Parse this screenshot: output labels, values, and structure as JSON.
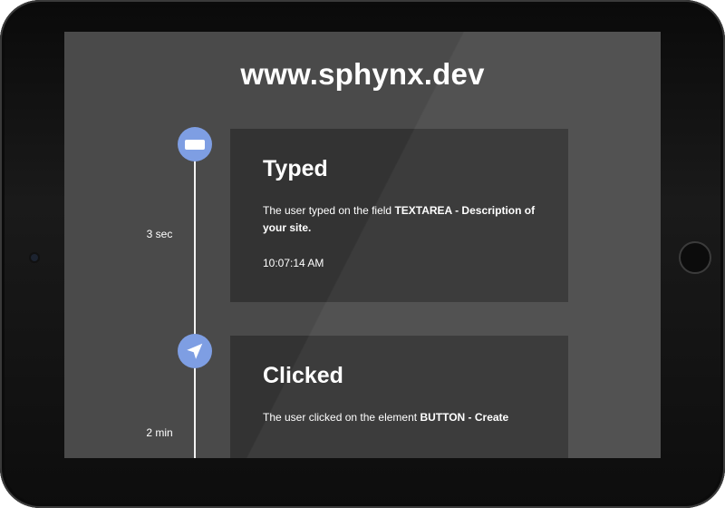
{
  "site": {
    "title": "www.sphynx.dev"
  },
  "events": [
    {
      "title": "Typed",
      "desc_prefix": "The user typed on the field ",
      "desc_strong": "TEXTAREA - Description of your site.",
      "time": "10:07:14 AM",
      "elapsed": "3 sec",
      "icon": "keyboard-icon"
    },
    {
      "title": "Clicked",
      "desc_prefix": "The user clicked on the element ",
      "desc_strong": "BUTTON - Create",
      "elapsed": "2 min",
      "icon": "cursor-arrow-icon"
    }
  ],
  "colors": {
    "screen_bg": "#4a4a4a",
    "card_bg": "#333333",
    "node_accent": "#7e9ee3",
    "text": "#ffffff"
  }
}
